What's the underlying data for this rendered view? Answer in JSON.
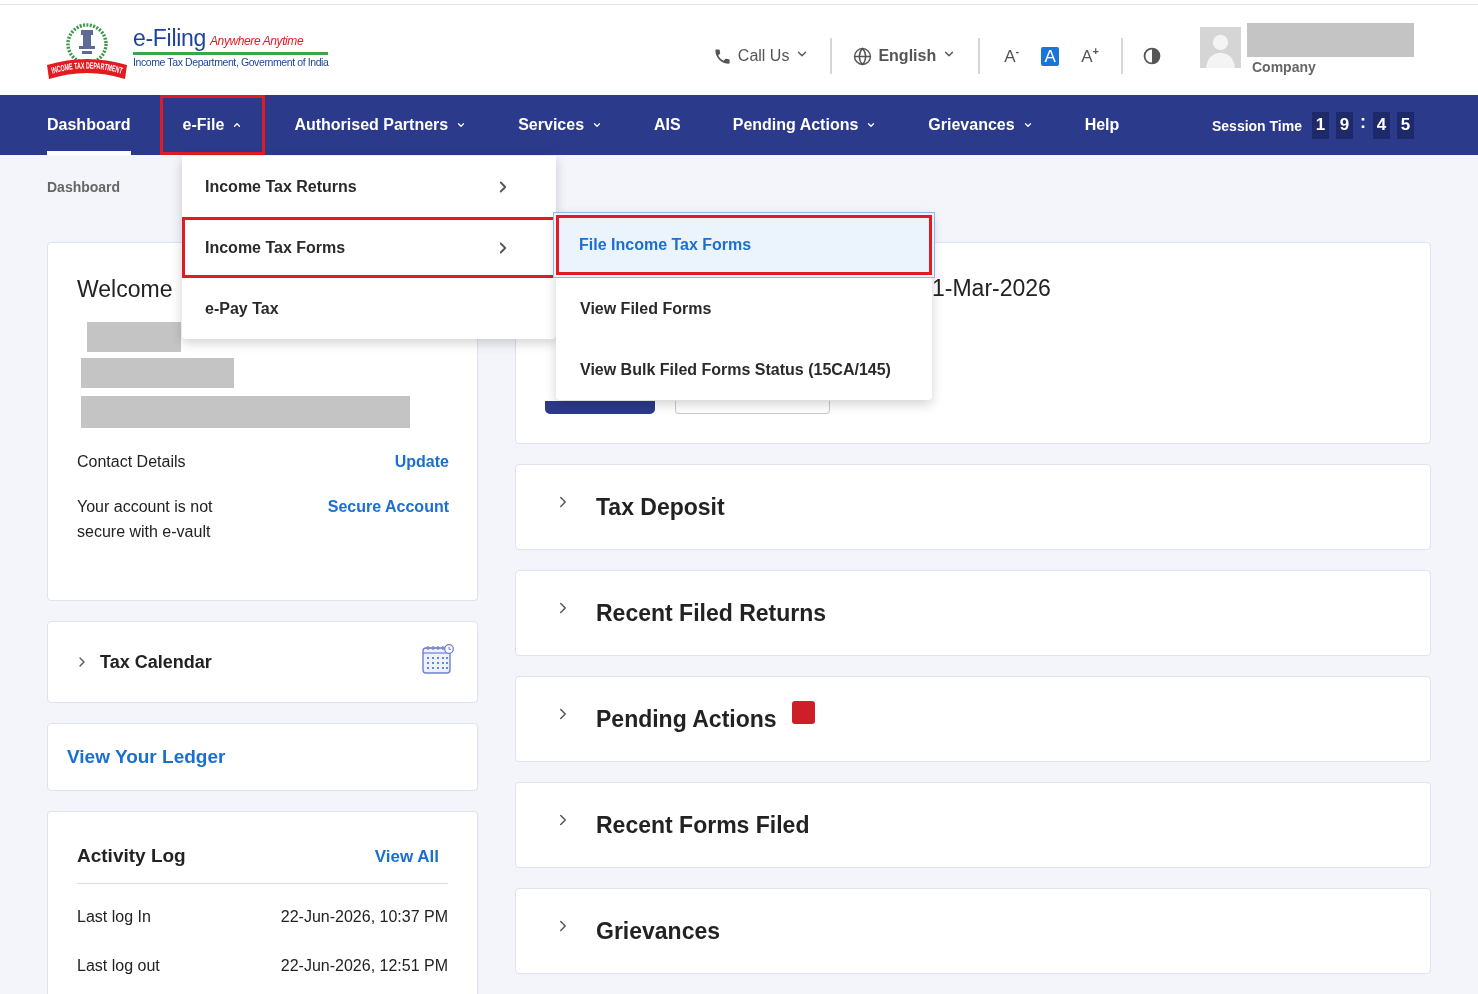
{
  "header": {
    "logo": {
      "title": "e-Filing",
      "tagline": "Anywhere Anytime",
      "subtitle": "Income Tax Department, Government of India",
      "ribbon": "INCOME TAX DEPARTMENT"
    },
    "tools": [
      {
        "kind": "call",
        "label": "Call Us"
      },
      {
        "kind": "language",
        "label": "English"
      }
    ],
    "font_sizes": [
      {
        "label": "A$^{-}$",
        "selected": false
      },
      {
        "label": "A",
        "selected": true
      },
      {
        "label": "A$^{+}$",
        "selected": false
      }
    ],
    "user": {
      "role": "Company"
    }
  },
  "nav": {
    "items": [
      {
        "label": "Dashboard",
        "selected": true,
        "annotated": false
      },
      {
        "label": "e-File",
        "selected": false,
        "annotated": true,
        "expanded": true
      },
      {
        "label": "Authorised Partners",
        "selected": false,
        "annotated": false,
        "expanded": false
      },
      {
        "label": "Services",
        "selected": false,
        "annotated": false,
        "expanded": false
      },
      {
        "label": "AIS",
        "selected": false,
        "annotated": false
      },
      {
        "label": "Pending Actions",
        "selected": false,
        "annotated": false,
        "expanded": false
      },
      {
        "label": "Grievances",
        "selected": false,
        "annotated": false,
        "expanded": false
      },
      {
        "label": "Help",
        "selected": false,
        "annotated": false
      }
    ],
    "session": {
      "label": "Session Time",
      "minutes": [
        "1",
        "9"
      ],
      "separator": ":",
      "seconds": [
        "4",
        "5"
      ]
    }
  },
  "efile_menu": {
    "items": [
      {
        "label": "Income Tax Returns",
        "has_submenu": true,
        "annotated": false
      },
      {
        "label": "Income Tax Forms",
        "has_submenu": true,
        "annotated": true
      },
      {
        "label": "e-Pay Tax",
        "has_submenu": false,
        "annotated": false
      }
    ],
    "submenu": {
      "items": [
        {
          "label": "File Income Tax Forms",
          "selected": true,
          "annotated": true
        },
        {
          "label": "View Filed Forms",
          "selected": false,
          "annotated": false
        },
        {
          "label": "View Bulk Filed Forms Status (15CA/145)",
          "selected": false,
          "annotated": false
        }
      ]
    }
  },
  "breadcrumb": [
    "Dashboard"
  ],
  "welcome_card": {
    "title": "Welcome",
    "contact_label": "Contact Details",
    "contact_link": "Update",
    "security_note": "Your account is not secure with e-vault",
    "security_link": "Secure Account"
  },
  "tax_calendar": {
    "title": "Tax Calendar",
    "expanded": false
  },
  "ledger": {
    "link": "View Your Ledger"
  },
  "activity_log": {
    "title": "Activity Log",
    "link": "View All",
    "rows": [
      {
        "label": "Last log In",
        "value": "22-Jun-2026, 10:37 PM"
      },
      {
        "label": "Last log out",
        "value": "22-Jun-2026, 12:51 PM"
      }
    ]
  },
  "overview_card": {
    "date": "1-Mar-2026"
  },
  "sections": [
    {
      "title": "Tax Deposit",
      "expanded": false,
      "alert": false
    },
    {
      "title": "Recent Filed Returns",
      "expanded": false,
      "alert": false
    },
    {
      "title": "Pending Actions",
      "expanded": false,
      "alert": true
    },
    {
      "title": "Recent Forms Filed",
      "expanded": false,
      "alert": false
    },
    {
      "title": "Grievances",
      "expanded": false,
      "alert": false
    }
  ]
}
